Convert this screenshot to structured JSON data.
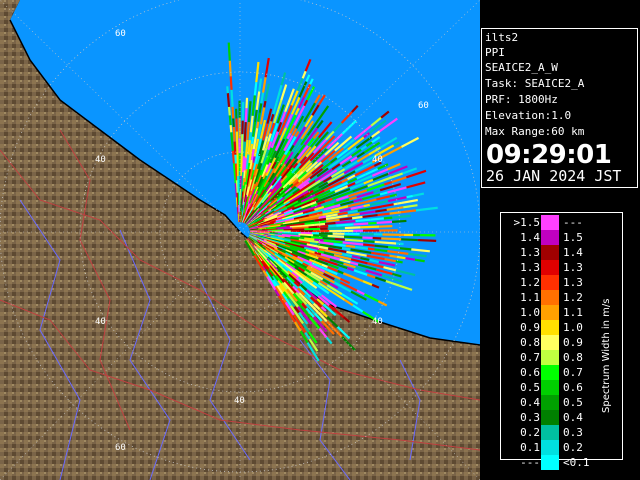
{
  "info": {
    "site": "ilts2",
    "product": "PPI",
    "product_name": "SEAICE2_A_W",
    "task": "Task: SEAICE2_A",
    "prf": "PRF: 1800Hz",
    "elevation": "Elevation:1.0",
    "max_range": "Max Range:60 km",
    "time": "09:29:01",
    "date": "26 JAN 2024 JST"
  },
  "legend": {
    "title": "Spectrum Width in m/s",
    "rows": [
      {
        "left": ">1.5",
        "right": "---",
        "color": "#ff40ff"
      },
      {
        "left": "1.4",
        "right": "1.5",
        "color": "#c000c0"
      },
      {
        "left": "1.3",
        "right": "1.4",
        "color": "#a00000"
      },
      {
        "left": "1.3",
        "right": "1.3",
        "color": "#e00000"
      },
      {
        "left": "1.2",
        "right": "1.3",
        "color": "#ff3000"
      },
      {
        "left": "1.1",
        "right": "1.2",
        "color": "#ff7000"
      },
      {
        "left": "1.0",
        "right": "1.1",
        "color": "#ffa000"
      },
      {
        "left": "0.9",
        "right": "1.0",
        "color": "#ffe000"
      },
      {
        "left": "0.8",
        "right": "0.9",
        "color": "#ffff60"
      },
      {
        "left": "0.7",
        "right": "0.8",
        "color": "#c0ff40"
      },
      {
        "left": "0.6",
        "right": "0.7",
        "color": "#00ff00"
      },
      {
        "left": "0.5",
        "right": "0.6",
        "color": "#00d000"
      },
      {
        "left": "0.4",
        "right": "0.5",
        "color": "#00a000"
      },
      {
        "left": "0.3",
        "right": "0.4",
        "color": "#008000"
      },
      {
        "left": "0.2",
        "right": "0.3",
        "color": "#00c0a0"
      },
      {
        "left": "0.1",
        "right": "0.2",
        "color": "#00e0e0"
      },
      {
        "left": "---",
        "right": "<0.1",
        "color": "#00ffff"
      }
    ]
  },
  "map": {
    "range_labels": [
      "60",
      "60",
      "40",
      "40",
      "40",
      "40",
      "40",
      "60"
    ],
    "colors": {
      "sea": "#0090ff",
      "land": "#7a6040",
      "background": "#000000"
    }
  }
}
